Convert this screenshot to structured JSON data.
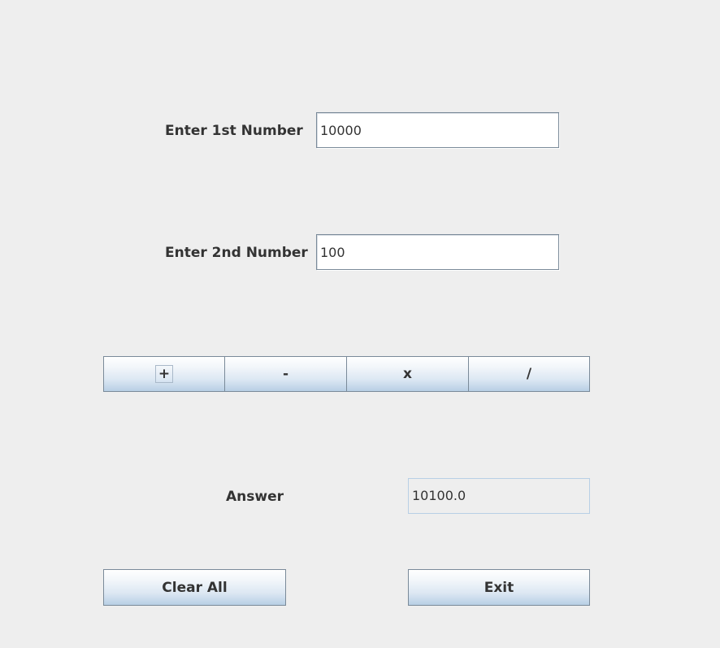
{
  "form": {
    "first_label": "Enter 1st Number",
    "first_value": "10000",
    "second_label": "Enter 2nd Number",
    "second_value": "100",
    "answer_label": "Answer",
    "answer_value": "10100.0"
  },
  "operators": {
    "add_label": "+",
    "subtract_label": "-",
    "multiply_label": "x",
    "divide_label": "/"
  },
  "actions": {
    "clear_label": "Clear All",
    "exit_label": "Exit"
  },
  "colors": {
    "background": "#eeeeee",
    "button_gradient_bottom": "#b8cfe5",
    "border": "#7a8a99",
    "text": "#333333"
  }
}
